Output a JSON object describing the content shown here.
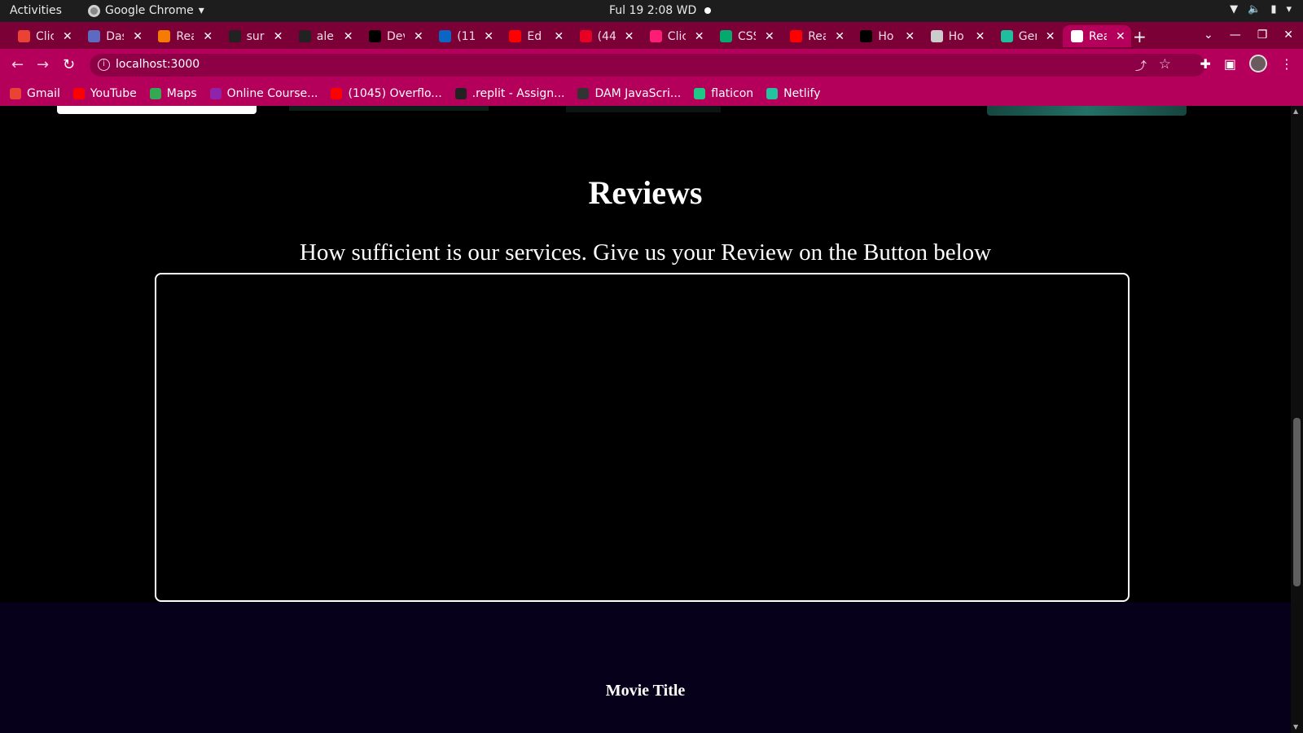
{
  "system": {
    "activities": "Activities",
    "app_name": "Google Chrome",
    "clock": "Ful 19  2:08 WD"
  },
  "tabs": [
    {
      "title": "Clic",
      "color": "#ea4335",
      "active": false
    },
    {
      "title": "Das",
      "color": "#5c6bc0",
      "active": false
    },
    {
      "title": "Rea",
      "color": "#f57c00",
      "active": false
    },
    {
      "title": "sur",
      "color": "#222222",
      "active": false
    },
    {
      "title": "ale",
      "color": "#222222",
      "active": false
    },
    {
      "title": "Dev",
      "color": "#000000",
      "active": false
    },
    {
      "title": "(11",
      "color": "#0a66c2",
      "active": false
    },
    {
      "title": "Ed",
      "color": "#ff0000",
      "active": false
    },
    {
      "title": "(44",
      "color": "#e60023",
      "active": false
    },
    {
      "title": "Clic",
      "color": "#ff1c74",
      "active": false
    },
    {
      "title": "CSS",
      "color": "#04aa6d",
      "active": false
    },
    {
      "title": "Rea",
      "color": "#ff0000",
      "active": false
    },
    {
      "title": "Ho",
      "color": "#000000",
      "active": false
    },
    {
      "title": "Ho",
      "color": "#cccccc",
      "active": false
    },
    {
      "title": "Ger",
      "color": "#1dbf9f",
      "active": false
    },
    {
      "title": "Rea",
      "color": "#ffffff",
      "active": true
    }
  ],
  "toolbar": {
    "url": "localhost:3000"
  },
  "bookmarks": [
    {
      "label": "Gmail",
      "color": "#ea4335"
    },
    {
      "label": "YouTube",
      "color": "#ff0000"
    },
    {
      "label": "Maps",
      "color": "#34a853"
    },
    {
      "label": "Online Course...",
      "color": "#8e24aa"
    },
    {
      "label": "(1045) Overflo...",
      "color": "#ff0000"
    },
    {
      "label": ".replit - Assign...",
      "color": "#222222"
    },
    {
      "label": "DAM JavaScri...",
      "color": "#333333"
    },
    {
      "label": "flaticon",
      "color": "#1ec886"
    },
    {
      "label": "Netlify",
      "color": "#25c2a0"
    }
  ],
  "page": {
    "reviews_title": "Reviews",
    "reviews_subtitle": "How sufficient is our services. Give us your Review on the Button below",
    "movie_title": "Movie Title"
  },
  "colors": {
    "chrome_theme": "#b4005b",
    "tabstrip": "#7a0035",
    "page_bg": "#000000",
    "footer_bg": "#07001a"
  }
}
